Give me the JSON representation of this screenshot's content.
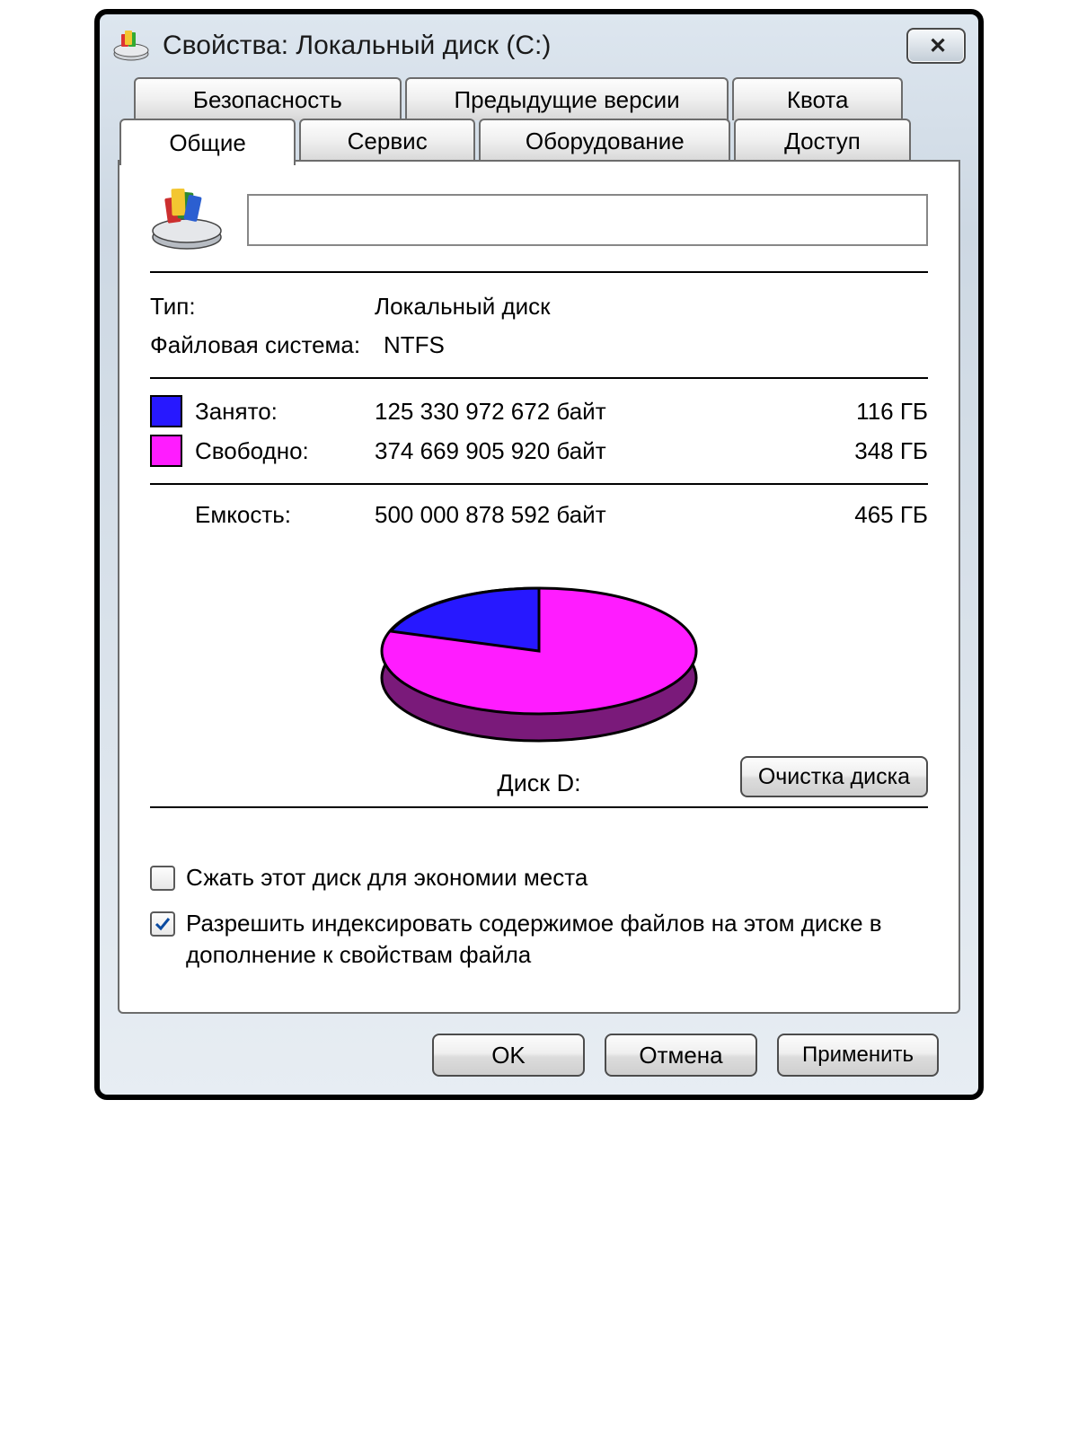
{
  "window": {
    "title": "Свойства: Локальный диск (C:)"
  },
  "tabs": {
    "security": "Безопасность",
    "previous": "Предыдущие версии",
    "quota": "Квота",
    "general": "Общие",
    "tools": "Сервис",
    "hardware": "Оборудование",
    "sharing": "Доступ"
  },
  "info": {
    "type_label": "Тип:",
    "type_value": "Локальный диск",
    "fs_label": "Файловая система:",
    "fs_value": "NTFS"
  },
  "usage": {
    "used_label": "Занято:",
    "used_bytes": "125 330 972 672 байт",
    "used_gb": "116 ГБ",
    "free_label": "Свободно:",
    "free_bytes": "374 669 905 920 байт",
    "free_gb": "348 ГБ",
    "capacity_label": "Емкость:",
    "capacity_bytes": "500 000 878 592 байт",
    "capacity_gb": "465 ГБ"
  },
  "chart_data": {
    "type": "pie",
    "title": "Диск D:",
    "series": [
      {
        "name": "Занято",
        "value": 125330972672,
        "display": "116 ГБ",
        "color": "#2718ff"
      },
      {
        "name": "Свободно",
        "value": 374669905920,
        "display": "348 ГБ",
        "color": "#ff1cff"
      }
    ],
    "total": {
      "name": "Емкость",
      "value": 500000878592,
      "display": "465 ГБ"
    }
  },
  "disk_name_label": "Диск D:",
  "cleanup_button": "Очистка диска",
  "checks": {
    "compress": {
      "label": "Сжать этот диск для экономии места",
      "checked": false
    },
    "index": {
      "label": "Разрешить индексировать содержимое файлов на этом диске в дополнение к свойствам файла",
      "checked": true
    }
  },
  "buttons": {
    "ok": "OK",
    "cancel": "Отмена",
    "apply": "Применить"
  },
  "colors": {
    "used": "#2718ff",
    "free": "#ff1cff"
  }
}
